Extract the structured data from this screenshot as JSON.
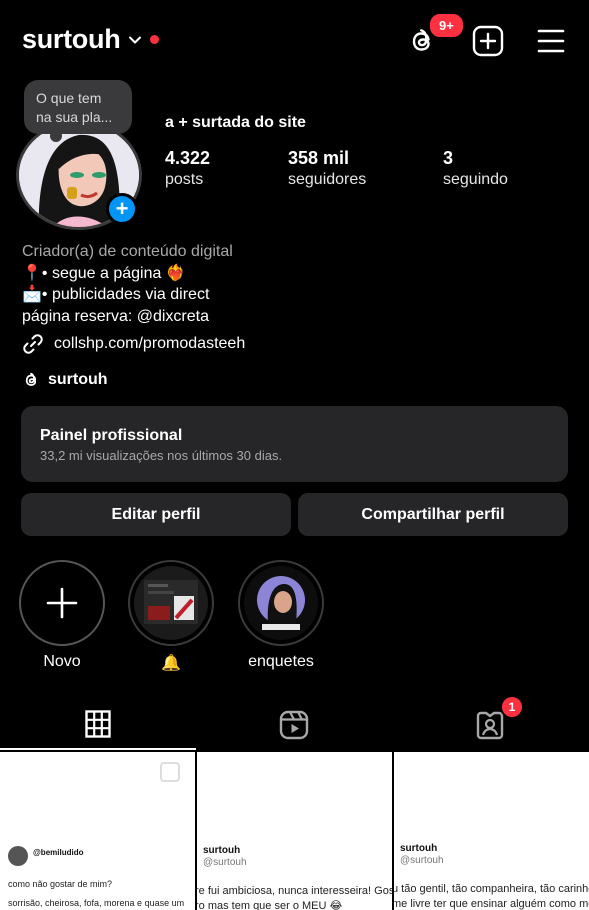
{
  "header": {
    "username": "surtouh",
    "threads_badge": "9+"
  },
  "note": {
    "line1": "O que tem",
    "line2": "na sua pla..."
  },
  "profile": {
    "display_name": "a + surtada do site",
    "stats": [
      {
        "value": "4.322",
        "label": "posts"
      },
      {
        "value": "358 mil",
        "label": "seguidores"
      },
      {
        "value": "3",
        "label": "seguindo"
      }
    ],
    "bio": {
      "category": "Criador(a) de conteúdo digital",
      "line1": "📍• segue a página ❤️‍🔥",
      "line2": "📩• publicidades via direct",
      "line3": "página reserva:  @dixcreta"
    },
    "link": "collshp.com/promodasteeh",
    "threads_handle": "surtouh"
  },
  "dashboard": {
    "title": "Painel profissional",
    "subtitle": "33,2 mi visualizações nos últimos 30 dias."
  },
  "actions": {
    "edit": "Editar perfil",
    "share": "Compartilhar perfil"
  },
  "highlights": [
    {
      "label": "Novo"
    },
    {
      "label": "🔔"
    },
    {
      "label": "enquetes"
    }
  ],
  "tabs": {
    "tagged_badge": "1"
  },
  "posts": [
    {
      "author": "@bemiludido",
      "text1": "como não gostar de mim?",
      "text2": "sorrisão, cheirosa, fofa, morena e quase um"
    },
    {
      "author": "surtouh",
      "handle": "@surtouh",
      "text1": "re fui ambiciosa, nunca interesseira! Gos",
      "text2": "ro mas tem que ser o MEU 😂"
    },
    {
      "author": "surtouh",
      "handle": "@surtouh",
      "text1": "u tão gentil, tão companheira, tão carinho",
      "text2": "me livre ter que ensinar alguém como me"
    }
  ],
  "colors": {
    "accent": "#0095f6",
    "badge": "#ff3040",
    "surface": "#262628"
  }
}
